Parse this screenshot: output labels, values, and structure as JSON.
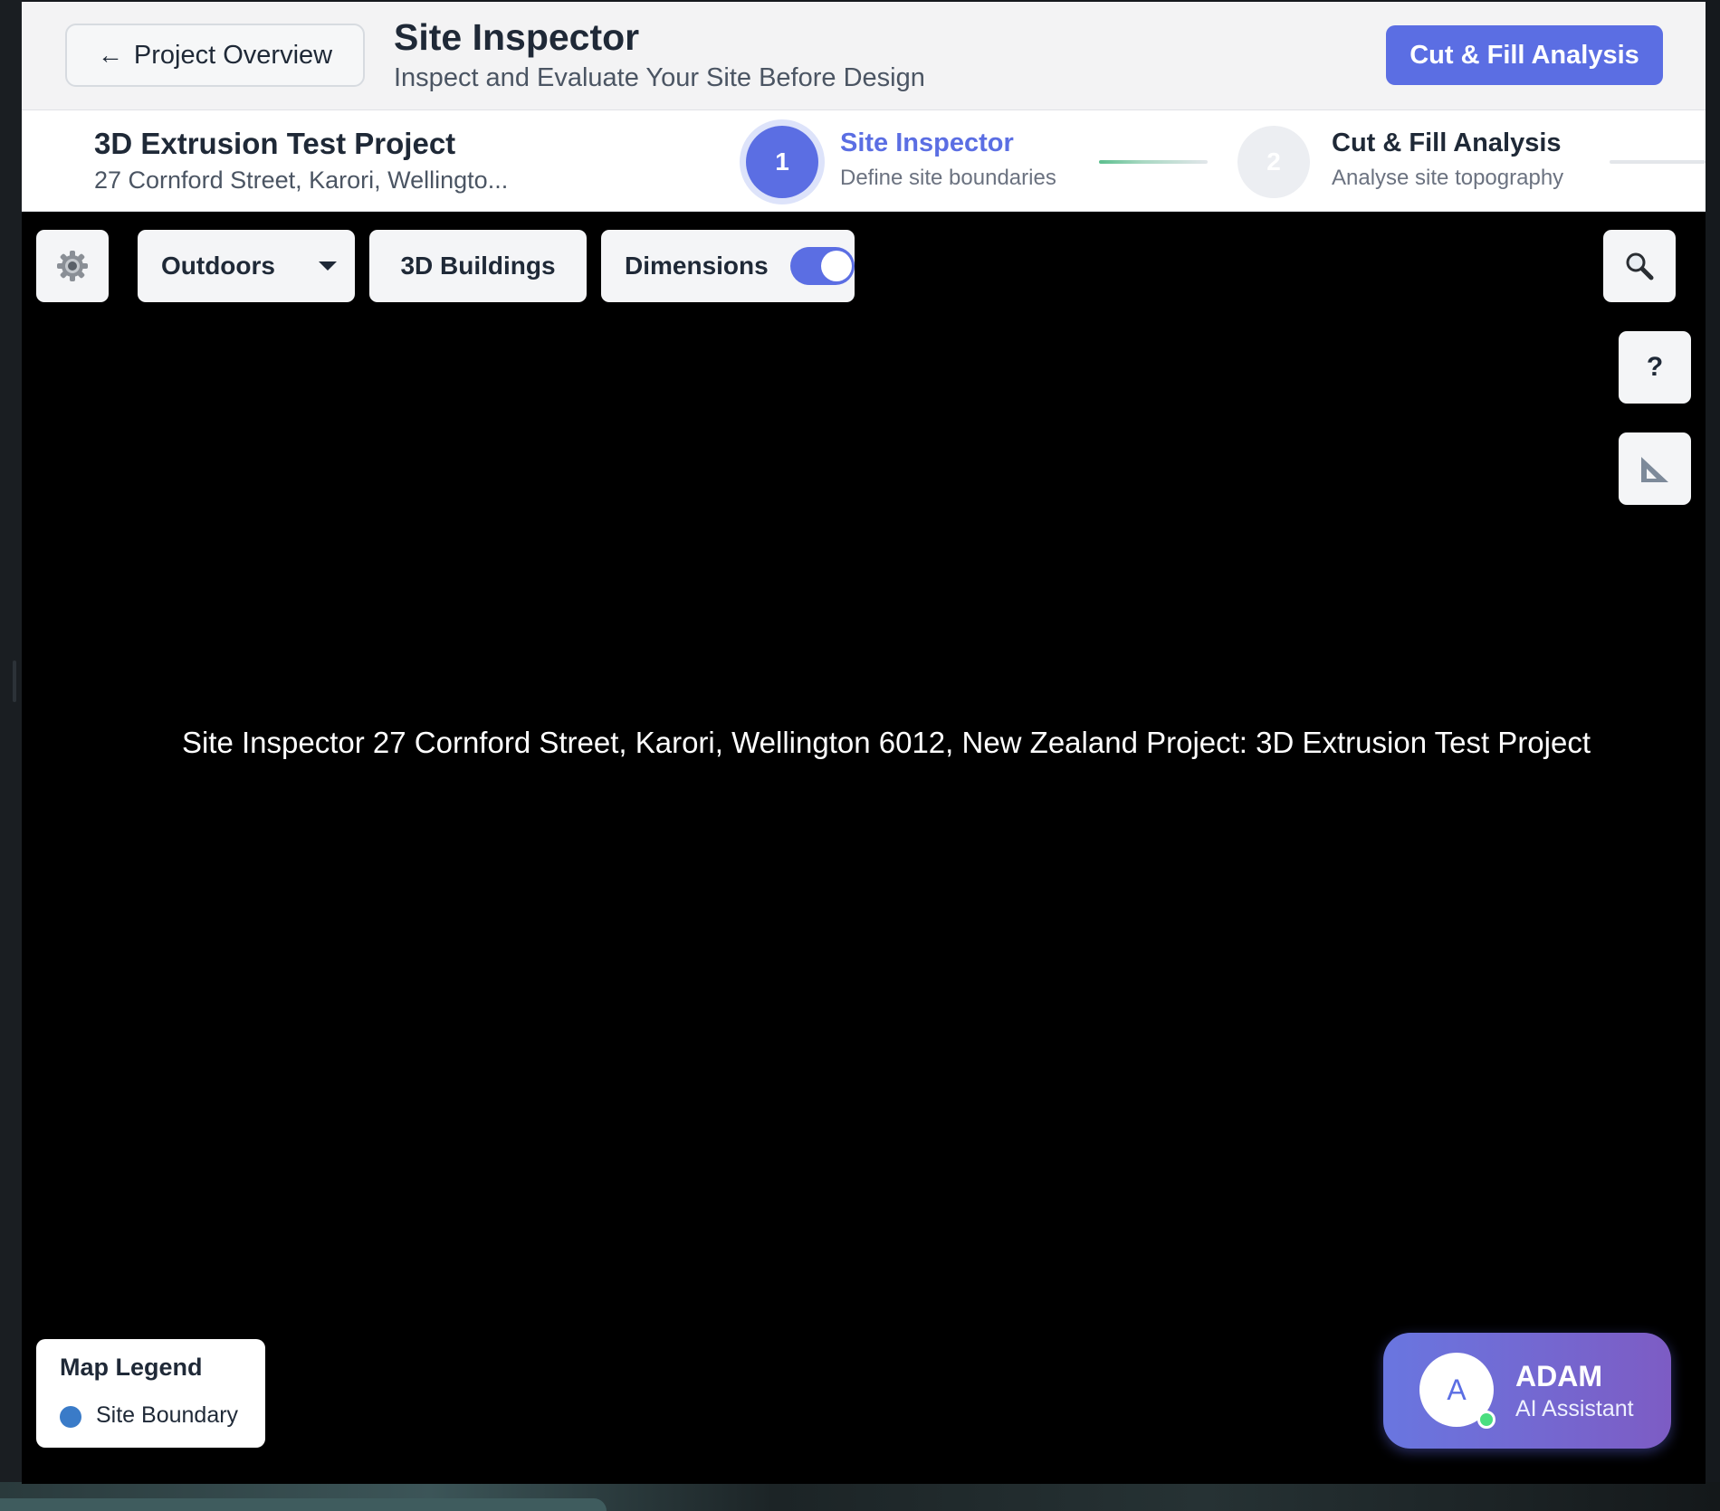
{
  "header": {
    "back_label": "Project Overview",
    "back_icon": "arrow-left-icon",
    "title": "Site Inspector",
    "subtitle": "Inspect and Evaluate Your Site Before Design",
    "cta_label": "Cut & Fill Analysis"
  },
  "project": {
    "name": "3D Extrusion Test Project",
    "address": "27 Cornford Street, Karori, Wellingto..."
  },
  "steps": [
    {
      "number": "1",
      "title": "Site Inspector",
      "subtitle": "Define site boundaries",
      "state": "active"
    },
    {
      "number": "2",
      "title": "Cut & Fill Analysis",
      "subtitle": "Analyse site topography",
      "state": "inactive"
    }
  ],
  "toolbar": {
    "settings_icon": "gear-icon",
    "map_style": "Outdoors",
    "buildings_label": "3D Buildings",
    "dimensions_label": "Dimensions",
    "dimensions_on": true,
    "search_icon": "search-icon",
    "help_label": "?",
    "measure_icon": "set-square-icon"
  },
  "map": {
    "placeholder_text": "Site Inspector 27 Cornford Street, Karori, Wellington 6012, New Zealand Project: 3D Extrusion Test Project"
  },
  "legend": {
    "title": "Map Legend",
    "items": [
      {
        "label": "Site Boundary",
        "color": "#3a7bc8"
      }
    ]
  },
  "assistant": {
    "initial": "A",
    "name": "ADAM",
    "role": "AI Assistant",
    "status": "online"
  },
  "colors": {
    "accent": "#5b6ee3",
    "assistant_gradient_end": "#7d5cc4",
    "online": "#4ade80"
  }
}
